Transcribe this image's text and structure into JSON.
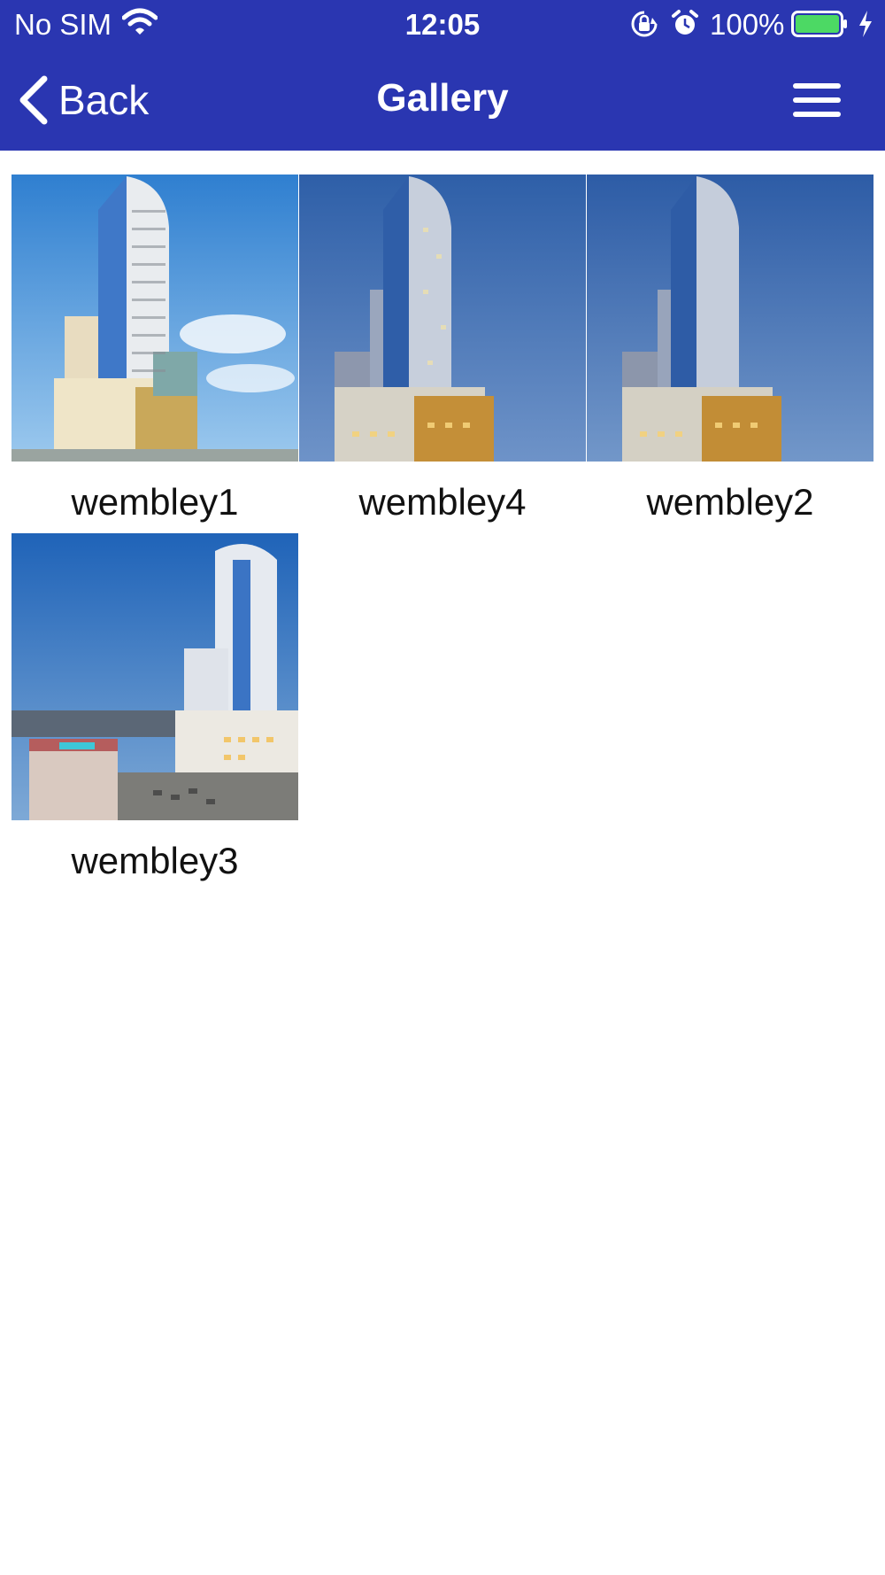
{
  "status_bar": {
    "carrier": "No SIM",
    "time": "12:05",
    "battery_percent": "100%",
    "battery_color": "#4cd964",
    "icons": [
      "wifi-icon",
      "orientation-lock-icon",
      "alarm-icon",
      "battery-icon",
      "charging-bolt-icon"
    ]
  },
  "nav": {
    "back_label": "Back",
    "title": "Gallery",
    "back_icon": "chevron-left-icon",
    "menu_icon": "hamburger-menu-icon"
  },
  "theme": {
    "header_bg": "#2a36b1",
    "header_text": "#ffffff"
  },
  "gallery": {
    "items": [
      {
        "caption": "wembley1"
      },
      {
        "caption": "wembley4"
      },
      {
        "caption": "wembley2"
      },
      {
        "caption": "wembley3"
      }
    ]
  }
}
